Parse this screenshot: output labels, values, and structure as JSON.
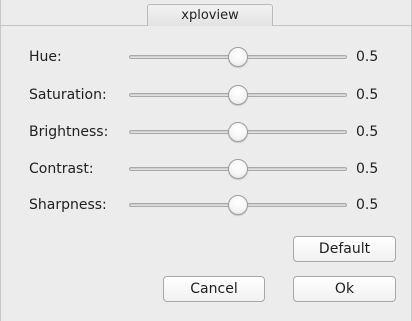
{
  "window": {
    "title": "xploview"
  },
  "sliders": [
    {
      "label": "Hue:",
      "value": "0.5",
      "level": 0.5
    },
    {
      "label": "Saturation:",
      "value": "0.5",
      "level": 0.5
    },
    {
      "label": "Brightness:",
      "value": "0.5",
      "level": 0.5
    },
    {
      "label": "Contrast:",
      "value": "0.5",
      "level": 0.5
    },
    {
      "label": "Sharpness:",
      "value": "0.5",
      "level": 0.5
    }
  ],
  "buttons": {
    "default_label": "Default",
    "cancel_label": "Cancel",
    "ok_label": "Ok"
  }
}
